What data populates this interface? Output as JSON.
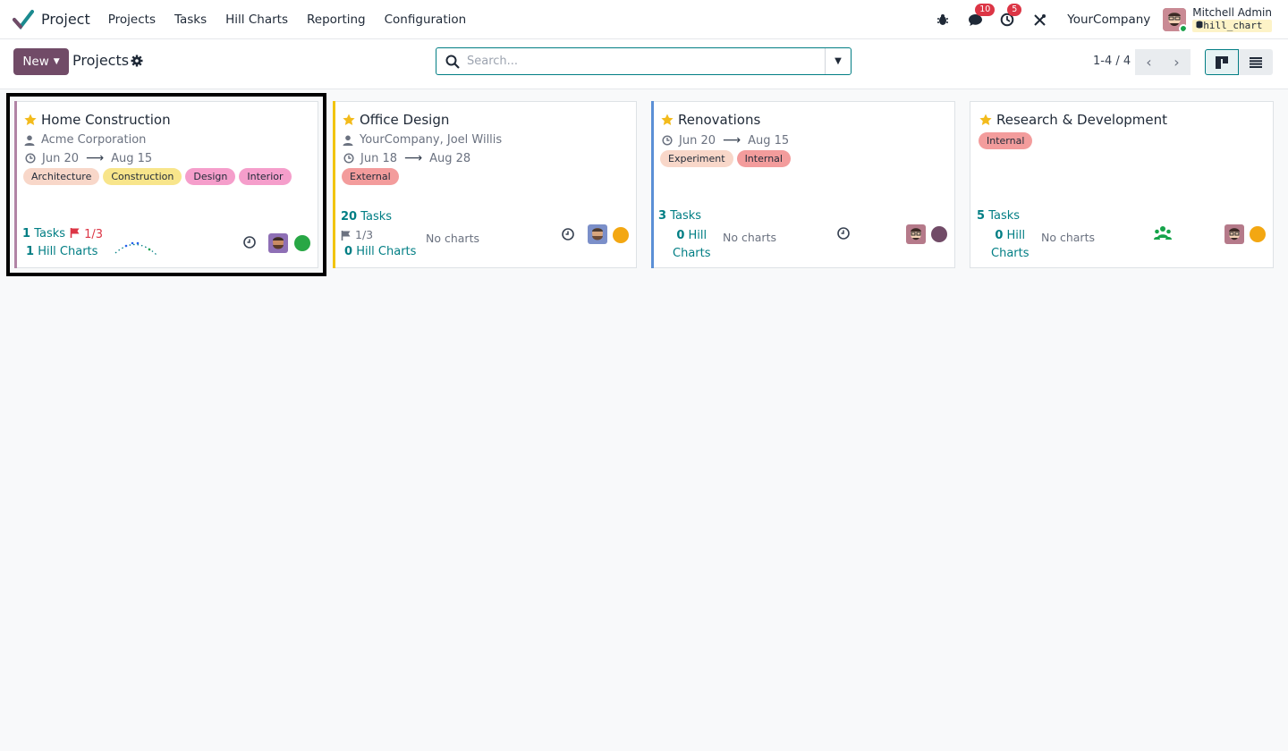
{
  "app": {
    "name": "Project"
  },
  "menu": [
    "Projects",
    "Tasks",
    "Hill Charts",
    "Reporting",
    "Configuration"
  ],
  "systray": {
    "messages_count": "10",
    "activities_count": "5",
    "company": "YourCompany",
    "user_name": "Mitchell Admin",
    "database": "hill_chart"
  },
  "control": {
    "new_label": "New",
    "title": "Projects",
    "search_placeholder": "Search...",
    "pager": "1-4 / 4"
  },
  "colors": {
    "brand": "#714b67",
    "link": "#017e84"
  },
  "projects": [
    {
      "name": "Home Construction",
      "customer": "Acme Corporation",
      "date_start": "Jun 20",
      "date_end": "Aug 15",
      "tags": [
        {
          "label": "Architecture",
          "color": "#f8d7c9"
        },
        {
          "label": "Construction",
          "color": "#f8e58b"
        },
        {
          "label": "Design",
          "color": "#f59ecb"
        },
        {
          "label": "Interior",
          "color": "#f59ecb"
        }
      ],
      "tasks_count": "1",
      "tasks_label": "Tasks",
      "milestones": "1/3",
      "hill_count": "1",
      "hill_label": "Hill Charts",
      "status_color": "#28a745",
      "accent": "#b184a5"
    },
    {
      "name": "Office Design",
      "customer": "YourCompany, Joel Willis",
      "date_start": "Jun 18",
      "date_end": "Aug 28",
      "tags": [
        {
          "label": "External",
          "color": "#f39c9c"
        }
      ],
      "tasks_count": "20",
      "tasks_label": "Tasks",
      "milestones": "1/3",
      "hill_count": "0",
      "hill_label": "Hill Charts",
      "no_charts": "No charts",
      "status_color": "#f3a712",
      "accent": "#f1c40f"
    },
    {
      "name": "Renovations",
      "date_start": "Jun 20",
      "date_end": "Aug 15",
      "tags": [
        {
          "label": "Experiment",
          "color": "#f8d7c9"
        },
        {
          "label": "Internal",
          "color": "#f39c9c"
        }
      ],
      "tasks_count": "3",
      "tasks_label": "Tasks",
      "hill_count": "0",
      "hill_label_1": "Hill",
      "hill_label_2": "Charts",
      "no_charts": "No charts",
      "status_color": "#714b67",
      "accent": "#5b8fd6"
    },
    {
      "name": "Research & Development",
      "tags": [
        {
          "label": "Internal",
          "color": "#f39c9c"
        }
      ],
      "tasks_count": "5",
      "tasks_label": "Tasks",
      "hill_count": "0",
      "hill_label_1": "Hill",
      "hill_label_2": "Charts",
      "no_charts": "No charts",
      "status_color": "#f3a712",
      "accent": ""
    }
  ]
}
